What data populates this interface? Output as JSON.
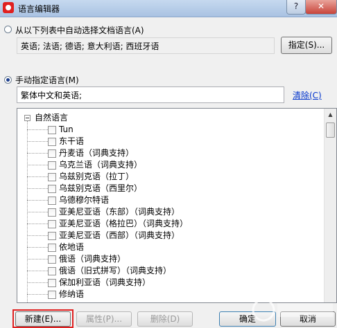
{
  "window": {
    "title": "语言编辑器",
    "help_label": "?",
    "close_label": "✕"
  },
  "auto_detect": {
    "label": "从以下列表中自动选择文档语言(A)",
    "value": "英语; 法语; 德语; 意大利语; 西班牙语",
    "button": "指定(S)..."
  },
  "manual": {
    "label": "手动指定语言(M)",
    "value": "繁体中文和英语;",
    "clear_link": "清除(C)"
  },
  "tree": {
    "root": "自然语言",
    "items": [
      "Tun",
      "东干语",
      "丹麦语（词典支持）",
      "乌克兰语（词典支持）",
      "乌兹别克语（拉丁）",
      "乌兹别克语（西里尔）",
      "乌德穆尔特语",
      "亚美尼亚语（东部）（词典支持）",
      "亚美尼亚语（格拉巴）（词典支持）",
      "亚美尼亚语（西部）（词典支持）",
      "依地语",
      "俄语（词典支持）",
      "俄语（旧式拼写）（词典支持）",
      "保加利亚语（词典支持）",
      "修纳语"
    ]
  },
  "footer": {
    "new_button": "新建(E)...",
    "properties_button": "属性(P)...",
    "delete_button": "删除(D)",
    "ok_button": "确定",
    "cancel_button": "取消"
  },
  "colors": {
    "highlight": "#e02020",
    "link": "#0033cc"
  }
}
